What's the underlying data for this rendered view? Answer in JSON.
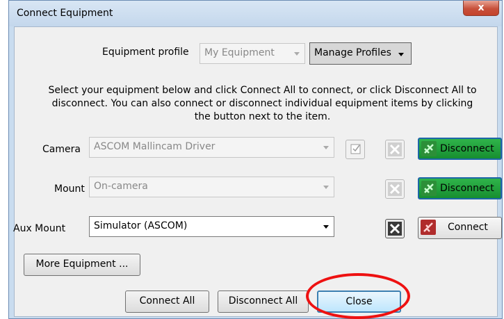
{
  "window": {
    "title": "Connect Equipment",
    "close_glyph": "x"
  },
  "profile": {
    "label": "Equipment profile",
    "value": "My Equipment",
    "manage_label": "Manage Profiles"
  },
  "instructions": "Select your equipment below and click Connect All to connect, or click Disconnect All to disconnect. You can also connect or disconnect individual equipment items by clicking the button next to the item.",
  "devices": [
    {
      "label": "Camera",
      "driver": "ASCOM Mallincam Driver",
      "enabled": false,
      "status": "connected",
      "action_label": "Disconnect"
    },
    {
      "label": "Mount",
      "driver": "On-camera",
      "enabled": false,
      "status": "connected",
      "action_label": "Disconnect"
    },
    {
      "label": "Aux Mount",
      "driver": "Simulator (ASCOM)",
      "enabled": true,
      "status": "disconnected",
      "action_label": "Connect"
    }
  ],
  "buttons": {
    "more_equipment": "More Equipment ...",
    "connect_all": "Connect All",
    "disconnect_all": "Disconnect All",
    "close": "Close"
  },
  "icons": {
    "settings": "wrench-screwdriver-icon",
    "options": "checkbox-icon",
    "plug_connected": "plug-connected-icon",
    "plug_disconnected": "plug-disconnected-icon"
  },
  "colors": {
    "connected_bg": "#1f9f3b",
    "disconnected_plug": "#b02c2c",
    "annotation": "#ee1111"
  }
}
